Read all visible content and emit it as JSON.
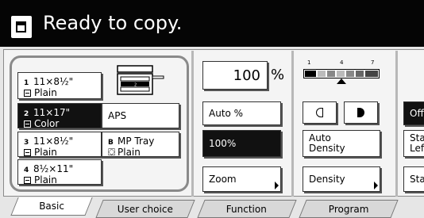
{
  "header": {
    "status": "Ready to copy."
  },
  "paper": {
    "cassettes": [
      {
        "num": "1",
        "size": "11×8½\"",
        "type": "Plain"
      },
      {
        "num": "2",
        "size": "11×17\"",
        "type": "Color"
      },
      {
        "num": "3",
        "size": "11×8½\"",
        "type": "Plain"
      },
      {
        "num": "4",
        "size": "8½×11\"",
        "type": "Plain"
      }
    ],
    "aps_label": "APS",
    "mp_tray": {
      "num": "B",
      "name": "MP Tray",
      "type": "Plain"
    }
  },
  "zoom": {
    "value": "100",
    "unit": "%",
    "auto_label": "Auto %",
    "preset_label": "100%",
    "zoom_label": "Zoom"
  },
  "density": {
    "scale_low": "1",
    "scale_mid": "4",
    "scale_high": "7",
    "auto_label_1": "Auto",
    "auto_label_2": "Density",
    "density_label": "Density"
  },
  "right_col": {
    "off_label": "Off",
    "staple_left_1": "Sta",
    "staple_left_2": "Lef",
    "staple_label": "Sta"
  },
  "tabs": [
    "Basic",
    "User choice",
    "Function",
    "Program"
  ]
}
